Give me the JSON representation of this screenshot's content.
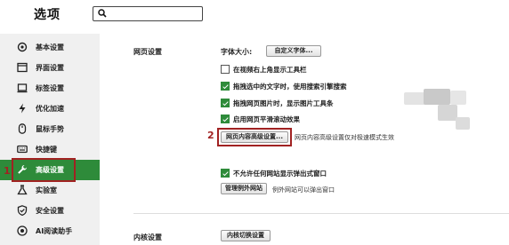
{
  "header": {
    "title": "选项",
    "search": {
      "value": "",
      "placeholder": ""
    }
  },
  "sidebar": {
    "items": [
      {
        "label": "基本设置",
        "icon": "gear-icon"
      },
      {
        "label": "界面设置",
        "icon": "window-icon"
      },
      {
        "label": "标签设置",
        "icon": "tab-icon"
      },
      {
        "label": "优化加速",
        "icon": "lightning-icon"
      },
      {
        "label": "鼠标手势",
        "icon": "mouse-icon"
      },
      {
        "label": "快捷键",
        "icon": "keyboard-icon"
      },
      {
        "label": "高级设置",
        "icon": "wrench-icon",
        "active": true
      },
      {
        "label": "实验室",
        "icon": "flask-icon"
      },
      {
        "label": "安全设置",
        "icon": "shield-icon"
      },
      {
        "label": "AI阅读助手",
        "icon": "ai-icon"
      }
    ],
    "annotation": "1"
  },
  "main": {
    "web_settings": {
      "label": "网页设置",
      "font_size_label": "字体大小:",
      "custom_font_button": "自定义字体...",
      "options": [
        {
          "label": "在视频右上角显示工具栏",
          "checked": false
        },
        {
          "label": "拖拽选中的文字时，使用搜索引擎搜索",
          "checked": true
        },
        {
          "label": "拖拽网页图片时，显示图片工具条",
          "checked": true
        },
        {
          "label": "启用网页平滑滚动效果",
          "checked": true
        }
      ],
      "advanced_content_button": "网页内容高级设置...",
      "advanced_content_note": "网页内容高级设置仅对极速模式生效",
      "annotation": "2",
      "popup_option": {
        "label": "不允许任何网站显示弹出式窗口",
        "checked": true
      },
      "manage_exceptions_button": "管理例外网站",
      "exceptions_note": "例外网站可以弹出窗口"
    },
    "kernel_settings": {
      "label": "内核设置",
      "button": "内核切换设置"
    }
  },
  "colors": {
    "accent_green": "#2e8b3a",
    "annotation_red": "#a12222",
    "sidebar_bg": "#f0f0f0"
  }
}
